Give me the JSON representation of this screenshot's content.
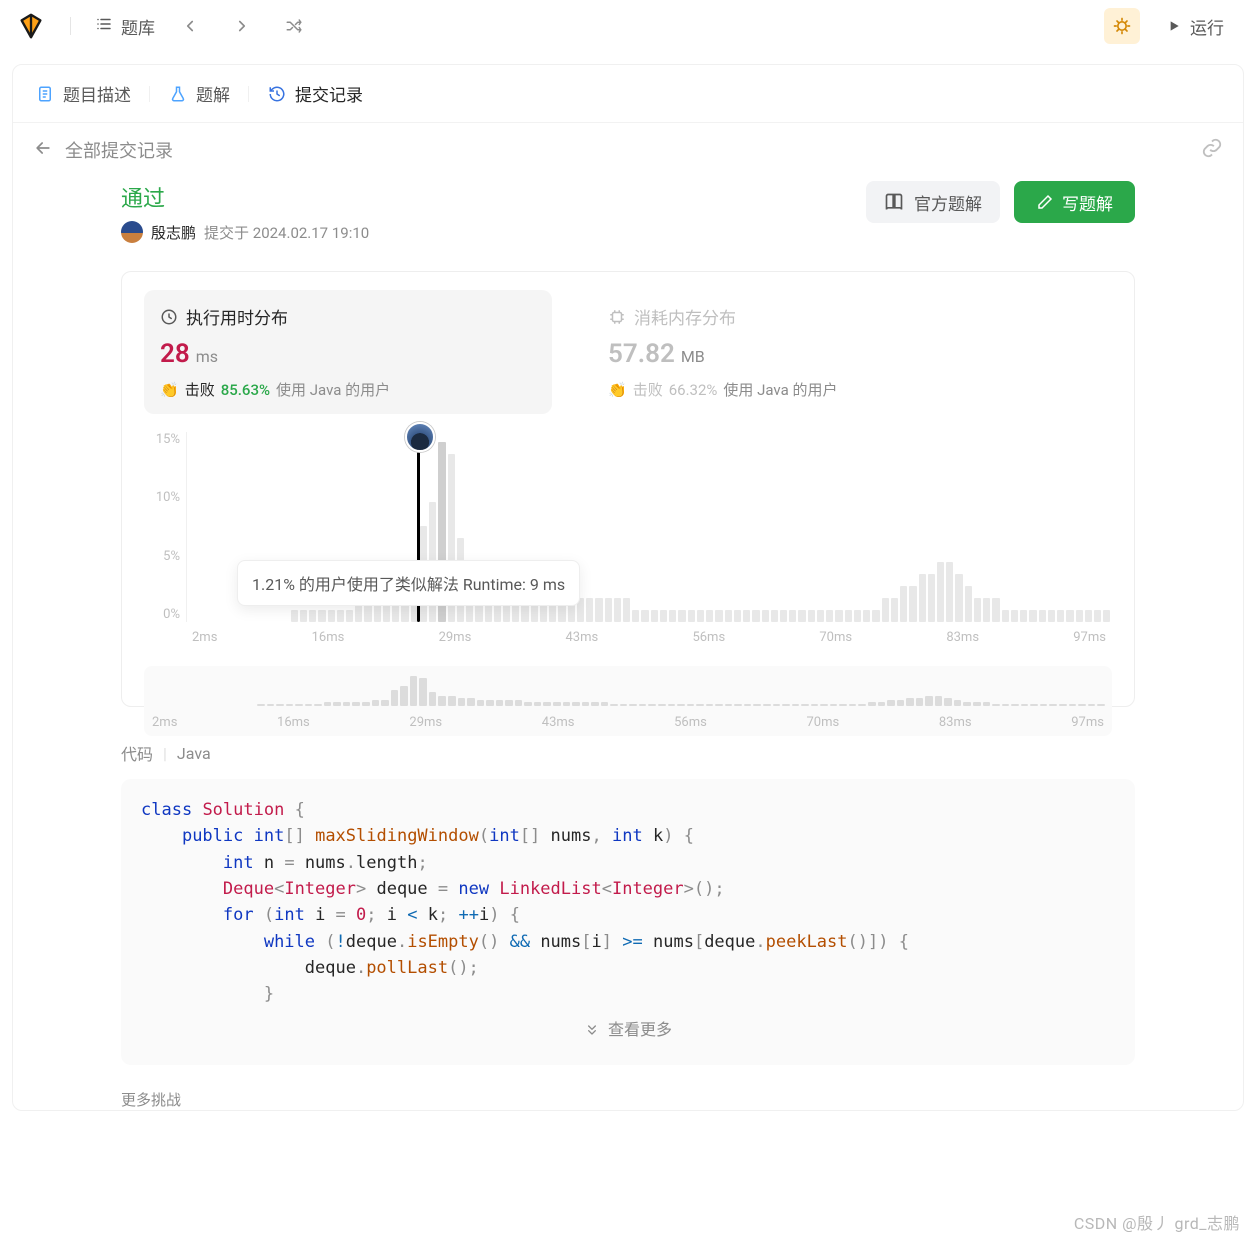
{
  "topbar": {
    "problems_label": "题库",
    "run_label": "运行"
  },
  "tabs": {
    "desc": "题目描述",
    "solution": "题解",
    "submissions": "提交记录"
  },
  "subheader": {
    "all_submissions": "全部提交记录"
  },
  "submission": {
    "status": "通过",
    "username": "殷志鹏",
    "submitted_prefix": "提交于",
    "submitted_at": "2024.02.17 19:10",
    "official_solution_btn": "官方题解",
    "write_solution_btn": "写题解"
  },
  "perf": {
    "runtime": {
      "title": "执行用时分布",
      "value": "28",
      "unit": "ms",
      "beat_prefix": "击败",
      "beat_pct": "85.63%",
      "using": "使用 Java 的用户"
    },
    "memory": {
      "title": "消耗内存分布",
      "value": "57.82",
      "unit": "MB",
      "beat_prefix": "击败",
      "beat_pct": "66.32%",
      "using": "使用 Java 的用户"
    }
  },
  "tooltip": "1.21% 的用户使用了类似解法 Runtime: 9 ms",
  "chart_data": {
    "type": "bar",
    "ylabel_ticks": [
      "15%",
      "10%",
      "5%",
      "0%"
    ],
    "x_ticks": [
      "2ms",
      "16ms",
      "29ms",
      "43ms",
      "56ms",
      "70ms",
      "83ms",
      "97ms"
    ],
    "highlight_index": 27,
    "values": [
      0,
      0,
      0,
      0,
      0,
      0,
      0,
      0,
      0,
      0,
      0,
      1,
      1,
      1,
      1,
      1,
      1,
      1,
      2,
      2,
      2,
      2,
      2,
      3,
      3,
      8,
      10,
      15,
      14,
      7,
      5,
      5,
      4,
      4,
      3,
      3,
      3,
      3,
      3,
      2,
      2,
      2,
      2,
      2,
      2,
      2,
      2,
      2,
      1,
      1,
      1,
      1,
      1,
      1,
      1,
      1,
      1,
      1,
      1,
      1,
      1,
      1,
      1,
      1,
      1,
      1,
      1,
      1,
      1,
      1,
      1,
      1,
      1,
      1,
      1,
      2,
      2,
      3,
      3,
      4,
      4,
      5,
      5,
      4,
      3,
      2,
      2,
      2,
      1,
      1,
      1,
      1,
      1,
      1,
      1,
      1,
      1,
      1,
      1,
      1
    ]
  },
  "mini_chart_data": {
    "x_ticks": [
      "2ms",
      "16ms",
      "29ms",
      "43ms",
      "56ms",
      "70ms",
      "83ms",
      "97ms"
    ],
    "values": [
      0,
      0,
      0,
      0,
      0,
      0,
      0,
      0,
      0,
      0,
      0,
      1,
      1,
      1,
      1,
      1,
      1,
      1,
      2,
      2,
      2,
      2,
      2,
      3,
      3,
      8,
      10,
      15,
      14,
      7,
      5,
      5,
      4,
      4,
      3,
      3,
      3,
      3,
      3,
      2,
      2,
      2,
      2,
      2,
      2,
      2,
      2,
      2,
      1,
      1,
      1,
      1,
      1,
      1,
      1,
      1,
      1,
      1,
      1,
      1,
      1,
      1,
      1,
      1,
      1,
      1,
      1,
      1,
      1,
      1,
      1,
      1,
      1,
      1,
      1,
      2,
      2,
      3,
      3,
      4,
      4,
      5,
      5,
      4,
      3,
      2,
      2,
      2,
      1,
      1,
      1,
      1,
      1,
      1,
      1,
      1,
      1,
      1,
      1,
      1
    ]
  },
  "code": {
    "label": "代码",
    "lang": "Java",
    "show_more": "查看更多",
    "text": "class Solution {\n    public int[] maxSlidingWindow(int[] nums, int k) {\n        int n = nums.length;\n        Deque<Integer> deque = new LinkedList<Integer>();\n        for (int i = 0; i < k; ++i) {\n            while (!deque.isEmpty() && nums[i] >= nums[deque.peekLast()]) {\n                deque.pollLast();\n            }"
  },
  "next_challenge_label": "更多挑战",
  "watermark": "CSDN @殷丿 grd_志鹏"
}
